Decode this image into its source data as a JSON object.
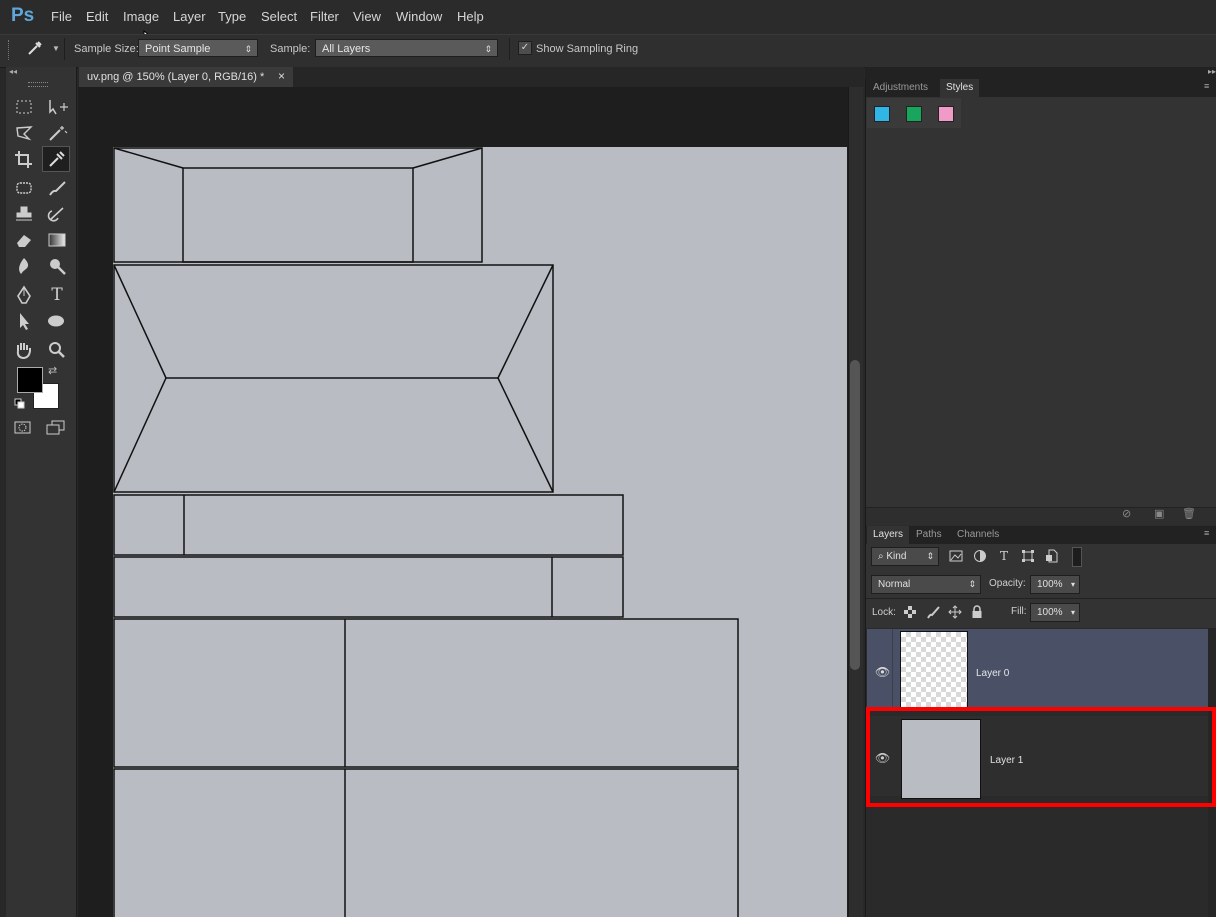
{
  "app": {
    "logo": "Ps"
  },
  "menu": [
    "File",
    "Edit",
    "Image",
    "Layer",
    "Type",
    "Select",
    "Filter",
    "View",
    "Window",
    "Help"
  ],
  "options": {
    "tool_icon": "eyedropper-icon",
    "sample_size_label": "Sample Size:",
    "sample_size_value": "Point Sample",
    "sample_label": "Sample:",
    "sample_value": "All Layers",
    "sampling_ring_label": "Show Sampling Ring",
    "sampling_ring_checked": true
  },
  "document": {
    "tab_title": "uv.png @ 150% (Layer 0, RGB/16) *",
    "close": "×",
    "canvas_color": "#b9bcc3"
  },
  "toolbox": {
    "collapse": "◂◂",
    "tools": [
      "marquee-icon",
      "move-icon",
      "lasso-icon",
      "magic-wand-icon",
      "crop-icon",
      "eyedropper-icon",
      "healing-brush-icon",
      "brush-icon",
      "clone-stamp-icon",
      "history-brush-icon",
      "eraser-icon",
      "gradient-icon",
      "blur-icon",
      "dodge-icon",
      "pen-icon",
      "type-icon",
      "path-selection-icon",
      "ellipse-icon",
      "hand-icon",
      "zoom-icon"
    ],
    "type_glyph": "T",
    "foreground_color": "#000000",
    "background_color": "#ffffff"
  },
  "adjustments_panel": {
    "tabs": [
      "Adjustments",
      "Styles"
    ],
    "active_tab": "Styles",
    "swatches": [
      "#2fb6e6",
      "#17a65b",
      "#f09ac8"
    ]
  },
  "layers_panel": {
    "tabs": [
      "Layers",
      "Paths",
      "Channels"
    ],
    "active_tab": "Layers",
    "filter_kind": "Kind",
    "blend_mode": "Normal",
    "opacity_label": "Opacity:",
    "opacity_value": "100%",
    "lock_label": "Lock:",
    "fill_label": "Fill:",
    "fill_value": "100%",
    "layers": [
      {
        "name": "Layer 0",
        "selected": true,
        "visible": true,
        "thumb": "transparent"
      },
      {
        "name": "Layer 1",
        "selected": false,
        "visible": true,
        "thumb": "#b9bcc3",
        "highlighted": true
      }
    ],
    "highlight_color": "#ff0000",
    "selected_row_color": "#4a5166"
  }
}
